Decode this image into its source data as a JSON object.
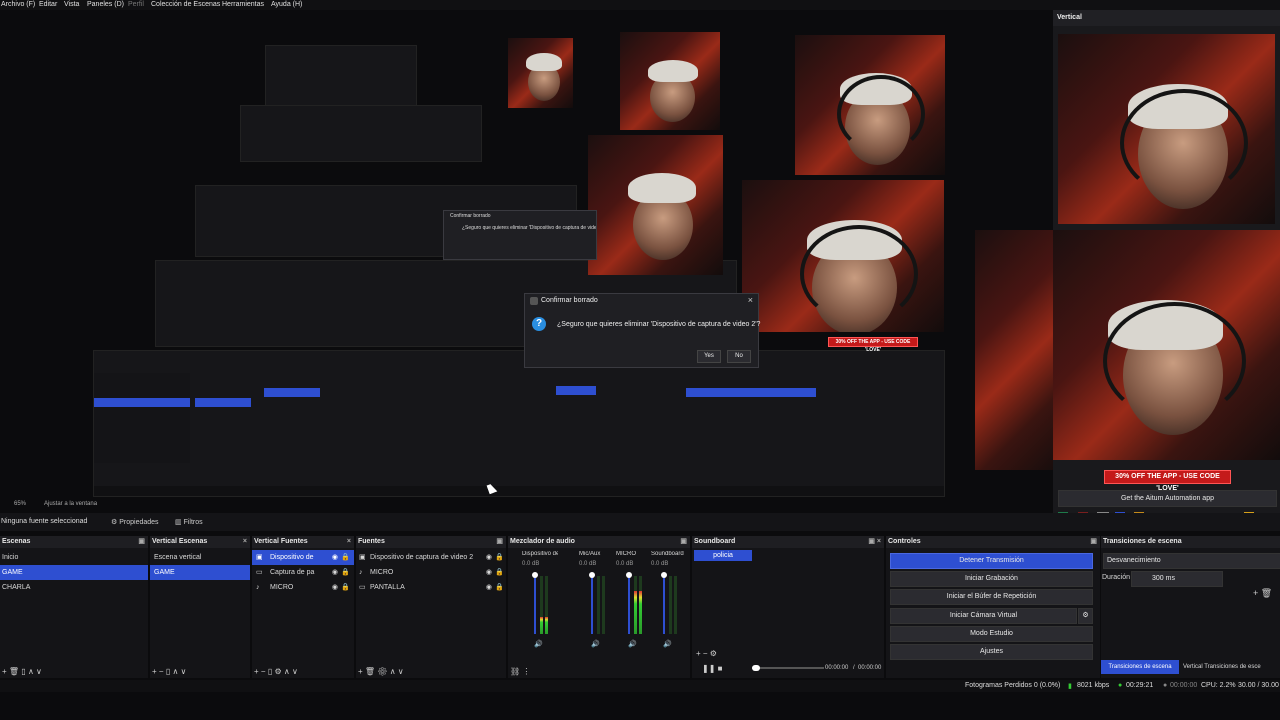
{
  "menu": {
    "items": [
      "Archivo (F)",
      "Editar",
      "Vista",
      "Paneles (D)",
      "Perfil",
      "Colección de Escenas",
      "Herramientas",
      "Ayuda (H)"
    ]
  },
  "vertical": {
    "title": "Vertical",
    "promo": "30% OFF THE APP - USE CODE 'LOVE'",
    "aitum_button": "Get the Aitum Automation app"
  },
  "dialog": {
    "title": "Confirmar borrado",
    "message": "¿Seguro que quieres eliminar 'Dispositivo de captura de video 2'?",
    "yes": "Yes",
    "no": "No"
  },
  "preview_bar": {
    "zoom": "65%",
    "fit": "Ajustar a la ventana"
  },
  "context": {
    "no_source": "Ninguna fuente seleccionad",
    "properties": "Propiedades",
    "filters": "Filtros"
  },
  "scenes": {
    "title": "Escenas",
    "items": [
      "Inicio",
      "GAME",
      "CHARLA"
    ],
    "selected": 1
  },
  "vertical_scenes": {
    "title": "Vertical Escenas",
    "items": [
      "Escena vertical",
      "GAME"
    ],
    "selected": 1
  },
  "vertical_sources": {
    "title": "Vertical Fuentes",
    "items": [
      "Dispositivo de",
      "Captura de pa",
      "MICRO"
    ],
    "selected": 0
  },
  "sources": {
    "title": "Fuentes",
    "items": [
      "Dispositivo de captura de video 2",
      "MICRO",
      "PANTALLA"
    ]
  },
  "mixer": {
    "title": "Mezclador de audio",
    "channels": [
      {
        "name": "Dispositivo de capt",
        "db": "0.0 dB",
        "level": 0.3
      },
      {
        "name": "Mic/Aux",
        "db": "0.0 dB",
        "level": 0.0
      },
      {
        "name": "MICRO",
        "db": "0.0 dB",
        "level": 0.75
      },
      {
        "name": "Soundboard",
        "db": "0.0 dB",
        "level": 0.0
      }
    ]
  },
  "soundboard": {
    "title": "Soundboard",
    "items": [
      "policia"
    ],
    "time": "00:00:00",
    "duration": "00:00:00"
  },
  "controls": {
    "title": "Controles",
    "buttons": [
      "Detener Transmisión",
      "Iniciar Grabación",
      "Iniciar el Búfer de Repetición",
      "Iniciar Cámara Virtual",
      "Modo Estudio",
      "Ajustes"
    ]
  },
  "transitions": {
    "title": "Transiciones de escena",
    "transition": "Desvanecimiento",
    "duration_label": "Duración",
    "duration": "300 ms",
    "tab_active": "Transiciones de escena",
    "tab_other": "Vertical Transiciones de esce"
  },
  "status": {
    "dropped": "Fotogramas Perdidos 0 (0.0%)",
    "bitrate": "8021 kbps",
    "live_time": "00:29:21",
    "rec_time": "00:00:00",
    "cpu": "CPU: 2.2%",
    "fps": "30.00 / 30.00"
  },
  "colors": {
    "accent": "#2e4fd1",
    "promo": "#c41a1a",
    "background": "#0b0b0d"
  }
}
